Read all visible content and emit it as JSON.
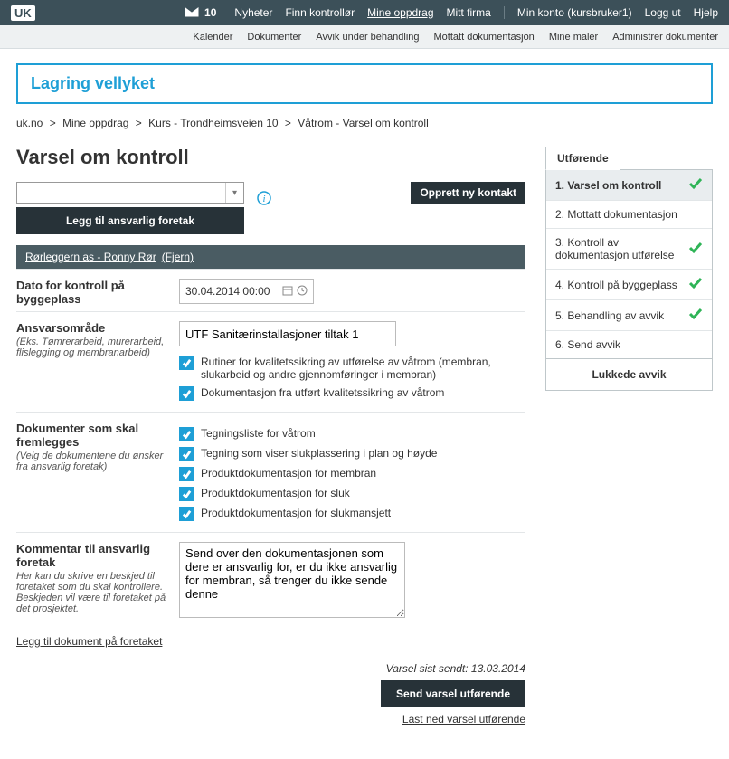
{
  "topbar": {
    "logo": "UK",
    "mail_count": "10",
    "nav": [
      "Nyheter",
      "Finn kontrollør",
      "Mine oppdrag",
      "Mitt firma"
    ],
    "active_nav_index": 2,
    "account_prefix": "Min konto",
    "account_user": "(kursbruker1)",
    "logout": "Logg ut",
    "help": "Hjelp"
  },
  "subbar": [
    "Kalender",
    "Dokumenter",
    "Avvik under behandling",
    "Mottatt dokumentasjon",
    "Mine maler",
    "Administrer dokumenter"
  ],
  "alert": "Lagring vellyket",
  "breadcrumb": {
    "items": [
      "uk.no",
      "Mine oppdrag",
      "Kurs - Trondheimsveien 10"
    ],
    "current": "Våtrom - Varsel om kontroll"
  },
  "title": "Varsel om kontroll",
  "buttons": {
    "add_responsible": "Legg til ansvarlig foretak",
    "new_contact": "Opprett ny kontakt",
    "send": "Send varsel utførende",
    "download": "Last ned varsel utførende",
    "doc_link": "Legg til dokument på foretaket"
  },
  "company": {
    "name": "Rørleggern as - Ronny Rør",
    "remove": "(Fjern)"
  },
  "form": {
    "date_label": "Dato for kontroll på byggeplass",
    "date_value": "30.04.2014 00:00",
    "area_label": "Ansvarsområde",
    "area_hint": "(Eks. Tømrerarbeid, murerarbeid, flislegging og membranarbeid)",
    "area_value": "UTF Sanitærinstallasjoner tiltak 1",
    "docs_label": "Dokumenter som skal fremlegges",
    "docs_hint": "(Velg de dokumentene du ønsker fra ansvarlig foretak)",
    "checks": [
      "Rutiner for kvalitetssikring av utførelse av våtrom (membran, slukarbeid og andre gjennomføringer i membran)",
      "Dokumentasjon fra utført kvalitetssikring av våtrom",
      "Tegningsliste for våtrom",
      "Tegning som viser slukplassering i plan og høyde",
      "Produktdokumentasjon for membran",
      "Produktdokumentasjon for sluk",
      "Produktdokumentasjon for slukmansjett"
    ],
    "comment_label": "Kommentar til ansvarlig foretak",
    "comment_hint": "Her kan du skrive en beskjed til foretaket som du skal kontrollere. Beskjeden vil være til foretaket på det prosjektet.",
    "comment_value": "Send over den dokumentasjonen som dere er ansvarlig for, er du ikke ansvarlig for membran, så trenger du ikke sende denne"
  },
  "sent_label": "Varsel sist sendt: 13.03.2014",
  "side": {
    "tab": "Utførende",
    "steps": [
      {
        "label": "1. Varsel om kontroll",
        "done": true,
        "active": true
      },
      {
        "label": "2. Mottatt dokumentasjon",
        "done": false
      },
      {
        "label": "3. Kontroll av dokumentasjon utførelse",
        "done": true
      },
      {
        "label": "4. Kontroll på byggeplass",
        "done": true
      },
      {
        "label": "5. Behandling av avvik",
        "done": true
      },
      {
        "label": "6. Send avvik",
        "done": false
      }
    ],
    "closed": "Lukkede avvik"
  }
}
